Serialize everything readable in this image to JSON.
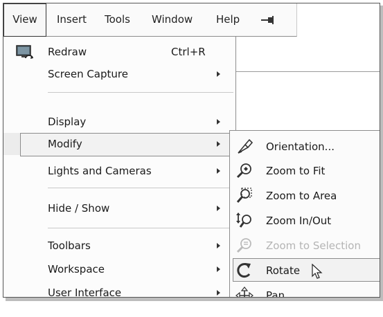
{
  "menubar": {
    "items": [
      "View",
      "Insert",
      "Tools",
      "Window",
      "Help"
    ],
    "pin_icon": "pin-icon"
  },
  "view_menu": {
    "items": [
      {
        "label": "Redraw",
        "shortcut": "Ctrl+R",
        "icon": "redraw-icon"
      },
      {
        "label": "Screen Capture",
        "submenu": true
      },
      {
        "label": "Display",
        "submenu": true
      },
      {
        "label": "Modify",
        "submenu": true,
        "highlighted": true
      },
      {
        "label": "Lights and Cameras",
        "submenu": true
      },
      {
        "label": "Hide / Show",
        "submenu": true
      },
      {
        "label": "Toolbars",
        "submenu": true
      },
      {
        "label": "Workspace",
        "submenu": true
      },
      {
        "label": "User Interface",
        "submenu": true
      }
    ]
  },
  "modify_submenu": {
    "items": [
      {
        "label": "Orientation...",
        "icon": "orientation-icon"
      },
      {
        "label": "Zoom to Fit",
        "icon": "zoom-to-fit-icon"
      },
      {
        "label": "Zoom to Area",
        "icon": "zoom-to-area-icon"
      },
      {
        "label": "Zoom In/Out",
        "icon": "zoom-in-out-icon"
      },
      {
        "label": "Zoom to Selection",
        "icon": "zoom-to-selection-icon",
        "disabled": true
      },
      {
        "label": "Rotate",
        "icon": "rotate-icon",
        "highlighted": true
      },
      {
        "label": "Pan",
        "icon": "pan-icon"
      }
    ]
  },
  "colors": {
    "menu_bg": "#fcfcfc",
    "highlight_border": "#8c8c8c",
    "disabled_text": "#b4b4b4"
  }
}
